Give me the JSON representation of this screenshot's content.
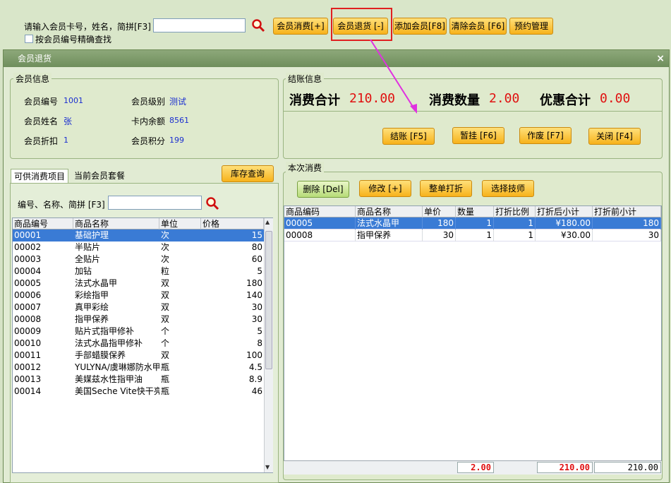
{
  "search": {
    "label": "请输入会员卡号，姓名，简拼[F3]",
    "value": "",
    "exact_label": "按会员编号精确查找"
  },
  "toolbar": {
    "consume": "会员消费[+]",
    "refund": "会员退货 [-]",
    "add": "添加会员[F8]",
    "clear": "清除会员 [F6]",
    "booking": "预约管理"
  },
  "dialog": {
    "title": "会员退货",
    "close": "×",
    "member_info": {
      "title": "会员信息",
      "id_label": "会员编号",
      "id": "1001",
      "level_label": "会员级别",
      "level": "测试",
      "name_label": "会员姓名",
      "name": "张",
      "balance_label": "卡内余额",
      "balance": "8561",
      "discount_label": "会员折扣",
      "discount": "1",
      "points_label": "会员积分",
      "points": "199"
    },
    "checkout": {
      "title": "结账信息",
      "total_label": "消费合计",
      "total": "210.00",
      "qty_label": "消费数量",
      "qty": "2.00",
      "discount_label": "优惠合计",
      "discount": "0.00",
      "btn_checkout": "结账 [F5]",
      "btn_hold": "暂挂 [F6]",
      "btn_void": "作废 [F7]",
      "btn_close": "关闭 [F4]"
    },
    "left": {
      "tab_items": "可供消费项目",
      "tab_packages": "当前会员套餐",
      "stock_btn": "库存查询",
      "search_label": "编号、名称、简拼 [F3]",
      "search_value": "",
      "headers": [
        "商品编号",
        "商品名称",
        "单位",
        "价格"
      ],
      "rows": [
        [
          "00001",
          "基础护理",
          "次",
          "15"
        ],
        [
          "00002",
          "半贴片",
          "次",
          "80"
        ],
        [
          "00003",
          "全贴片",
          "次",
          "60"
        ],
        [
          "00004",
          "加钻",
          "粒",
          "5"
        ],
        [
          "00005",
          "法式水晶甲",
          "双",
          "180"
        ],
        [
          "00006",
          "彩绘指甲",
          "双",
          "140"
        ],
        [
          "00007",
          "真甲彩绘",
          "双",
          "30"
        ],
        [
          "00008",
          "指甲保养",
          "双",
          "30"
        ],
        [
          "00009",
          "贴片式指甲修补",
          "个",
          "5"
        ],
        [
          "00010",
          "法式水晶指甲修补",
          "个",
          "8"
        ],
        [
          "00011",
          "手部蜡膜保养",
          "双",
          "100"
        ],
        [
          "00012",
          "YULYNA/虞琳娜防水甲油",
          "瓶",
          "4.5"
        ],
        [
          "00013",
          "美媒兹水性指甲油",
          "瓶",
          "8.9"
        ],
        [
          "00014",
          "美国Seche Vite快干亮油",
          "瓶",
          "46"
        ]
      ]
    },
    "right": {
      "title": "本次消费",
      "btn_delete": "删除 [Del]",
      "btn_modify": "修改 [+]",
      "btn_whole_discount": "整单打折",
      "btn_tech": "选择技师",
      "headers": [
        "商品编码",
        "商品名称",
        "单价",
        "数量",
        "打折比例",
        "打折后小计",
        "打折前小计"
      ],
      "rows": [
        [
          "00005",
          "法式水晶甲",
          "180",
          "1",
          "1",
          "¥180.00",
          "180"
        ],
        [
          "00008",
          "指甲保养",
          "30",
          "1",
          "1",
          "¥30.00",
          "30"
        ]
      ],
      "sum_qty": "2.00",
      "sum_after": "210.00",
      "sum_before": "210.00"
    }
  },
  "colors": {
    "accent_orange": "#f7b21b",
    "highlight_red": "#e01010",
    "selection_blue": "#3a7bd5"
  }
}
